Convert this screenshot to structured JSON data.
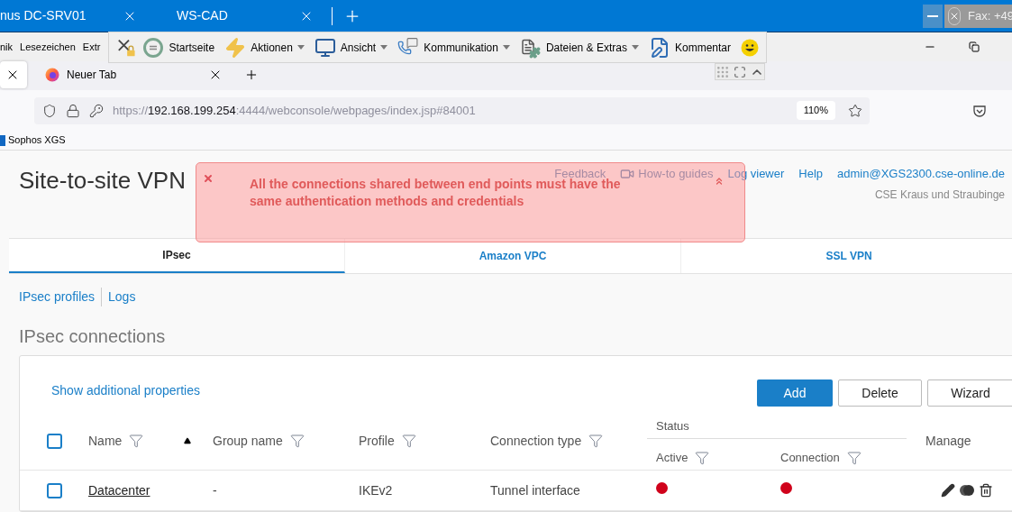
{
  "remote_tabs": [
    {
      "label": "nus DC-SRV01"
    },
    {
      "label": "WS-CAD"
    }
  ],
  "remote_status": "Fax: +49",
  "menu_bar": [
    "nik",
    "Lesezeichen",
    "Extr"
  ],
  "remote_toolbar": [
    {
      "label": "Startseite",
      "dropdown": false
    },
    {
      "label": "Aktionen",
      "dropdown": true
    },
    {
      "label": "Ansicht",
      "dropdown": true
    },
    {
      "label": "Kommunikation",
      "dropdown": true
    },
    {
      "label": "Dateien & Extras",
      "dropdown": true
    },
    {
      "label": "Kommentar",
      "dropdown": false
    }
  ],
  "browser_tabs": [
    {
      "selected": true
    },
    {
      "label": "Neuer Tab",
      "selected": false
    }
  ],
  "address_bar": {
    "url_scheme": "https://",
    "url_host": "192.168.199.254",
    "url_path": ":4444/webconsole/webpages/index.jsp#84001",
    "zoom": "110%"
  },
  "bookmarks": [
    "Sophos XGS"
  ],
  "page": {
    "title": "Site-to-site VPN",
    "header_links": [
      "Feedback",
      "How-to guides",
      "Log viewer",
      "Help"
    ],
    "user": "admin@XGS2300.cse-online.de",
    "organization": "CSE Kraus und Straubinge"
  },
  "alert": {
    "message": "All the connections shared between end points must have the same authentication methods and credentials"
  },
  "tabs": [
    {
      "label": "IPsec",
      "selected": true
    },
    {
      "label": "Amazon VPC",
      "selected": false
    },
    {
      "label": "SSL VPN",
      "selected": false
    }
  ],
  "sub_links": [
    "IPsec profiles",
    "Logs"
  ],
  "section_title": "IPsec connections",
  "connections": {
    "link": "Show additional properties",
    "buttons": [
      {
        "label": "Add",
        "primary": true
      },
      {
        "label": "Delete",
        "primary": false
      },
      {
        "label": "Wizard",
        "primary": false
      }
    ],
    "status_group": "Status",
    "columns": {
      "name": "Name",
      "group": "Group name",
      "profile": "Profile",
      "type": "Connection type",
      "active": "Active",
      "connection": "Connection",
      "manage": "Manage"
    },
    "name_sort_ascending": true,
    "all_checked": false,
    "rows": [
      {
        "checked": false,
        "name": "Datacenter",
        "group": "-",
        "profile": "IKEv2",
        "type": "Tunnel interface",
        "active": false,
        "connected": false
      }
    ]
  }
}
